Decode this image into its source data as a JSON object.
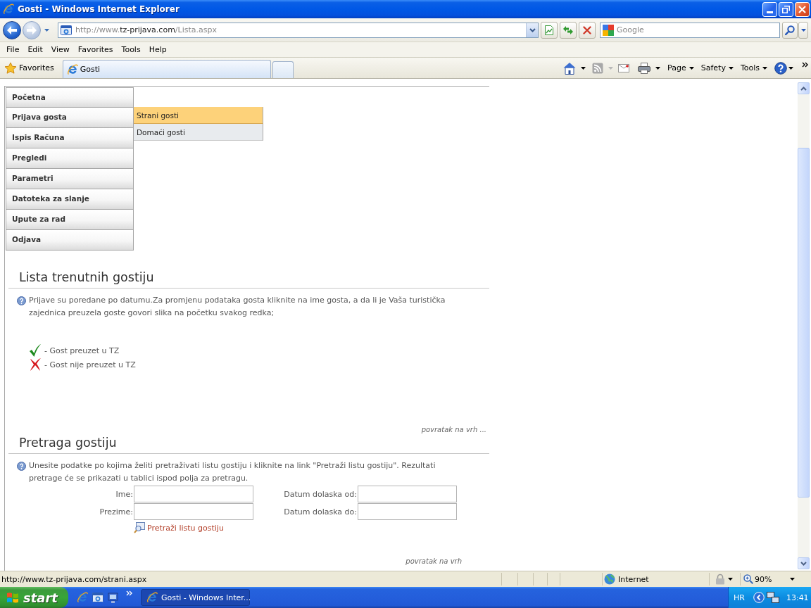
{
  "window": {
    "title": "Gosti - Windows Internet Explorer"
  },
  "address_bar": {
    "url_parts": [
      {
        "kind": "dim",
        "text": "http://www."
      },
      {
        "kind": "host",
        "text": "tz-prijava.com"
      },
      {
        "kind": "dim",
        "text": "/Lista.aspx"
      }
    ]
  },
  "search": {
    "placeholder": "Google"
  },
  "menu_bar": [
    "File",
    "Edit",
    "View",
    "Favorites",
    "Tools",
    "Help"
  ],
  "favorites_bar": {
    "favorites": "Favorites",
    "tabs": [
      {
        "label": "Gosti",
        "selected": true
      }
    ],
    "commands": [
      "Page",
      "Safety",
      "Tools"
    ]
  },
  "nav_menu": [
    {
      "label": "Početna"
    },
    {
      "label": "Prijava gosta",
      "submenu": [
        {
          "label": "Strani gosti",
          "selected": true
        },
        {
          "label": "Domaći gosti",
          "selected": false
        }
      ]
    },
    {
      "label": "Ispis Računa"
    },
    {
      "label": "Pregledi"
    },
    {
      "label": "Parametri"
    },
    {
      "label": "Datoteka za slanje"
    },
    {
      "label": "Upute za rad"
    },
    {
      "label": "Odjava"
    }
  ],
  "sections": [
    {
      "kind": "list",
      "title": "Lista trenutnih gostiju",
      "info": "Prijave su poredane po datumu.Za promjenu podataka gosta kliknite na ime gosta, a da li je Vaša turistička zajednica preuzela goste govori slika na početku svakog redka;",
      "legend": [
        {
          "kind": "taken",
          "label": "- Gost preuzet u TZ"
        },
        {
          "kind": "not-taken",
          "label": "- Gost nije preuzet u TZ"
        }
      ],
      "back_to_top": "povratak na vrh ..."
    },
    {
      "kind": "search",
      "title": "Pretraga gostiju",
      "info": "Unesite podatke po kojima želiti pretraživati listu gostiju i kliknite na link \"Pretraži listu gostiju\". Rezultati pretrage će se prikazati u tablici ispod polja za pretragu.",
      "form": {
        "fields": [
          {
            "label": "Ime:"
          },
          {
            "label": "Datum dolaska od:"
          },
          {
            "label": "Prezime:"
          },
          {
            "label": "Datum dolaska do:"
          }
        ],
        "search_link": "Pretraži listu gostiju"
      },
      "back_to_top": "povratak na vrh"
    }
  ],
  "status_bar": {
    "text": "http://www.tz-prijava.com/strani.aspx",
    "zone": "Internet",
    "zoom": "90%"
  },
  "taskbar": {
    "start": "start",
    "tasks": [
      {
        "label": "Gosti - Windows Inter...",
        "selected": true
      }
    ],
    "language": "HR",
    "clock": "13:41"
  }
}
